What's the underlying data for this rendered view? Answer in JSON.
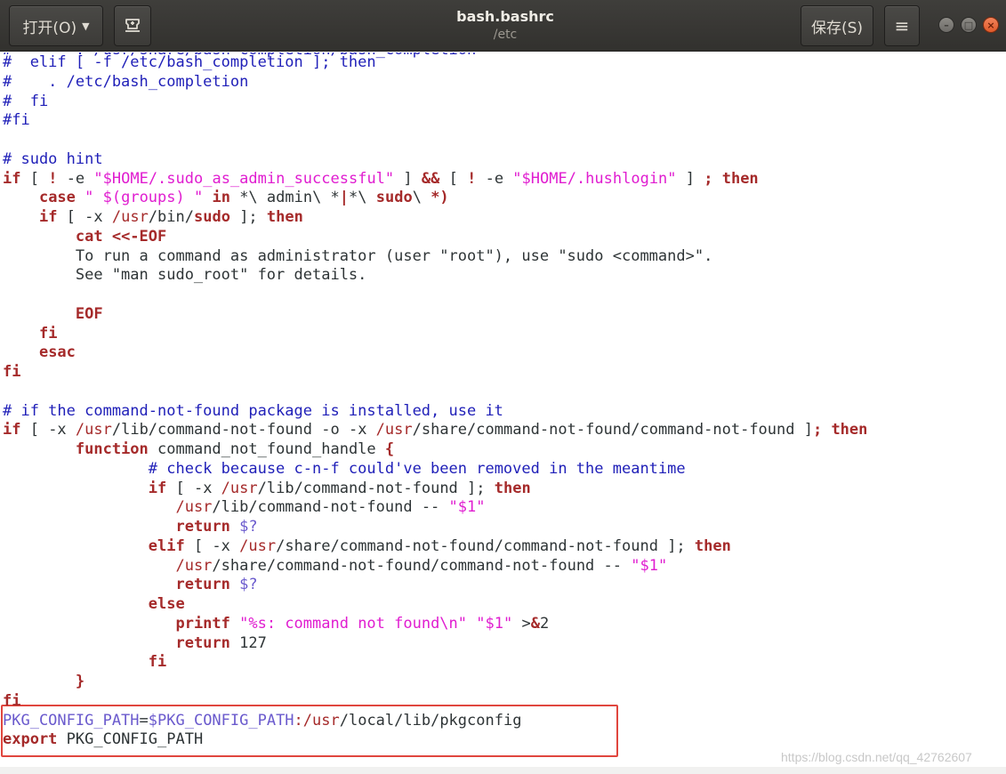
{
  "header": {
    "open_label": "打开(O)",
    "title": "bash.bashrc",
    "subtitle": "/etc",
    "save_label": "保存(S)",
    "pin_icon": "pin-icon",
    "menu_icon": "hamburger-menu-icon",
    "window_controls": [
      "minimize-icon",
      "maximize-icon",
      "close-icon"
    ]
  },
  "colors": {
    "comment": "#1f1fb8",
    "keyword": "#a52a2a",
    "string": "#e01dd0",
    "variable": "#6a5acd",
    "highlight_border": "#e0463e"
  },
  "editor": {
    "partial_top": "#       . /usr/share/bash-completion/bash_completion",
    "lines": [
      [
        [
          "comment",
          "#  elif [ -f /etc/bash_completion ]; then"
        ]
      ],
      [
        [
          "comment",
          "#    . /etc/bash_completion"
        ]
      ],
      [
        [
          "comment",
          "#  fi"
        ]
      ],
      [
        [
          "comment",
          "#fi"
        ]
      ],
      [],
      [
        [
          "comment",
          "# sudo hint"
        ]
      ],
      [
        [
          "keyword",
          "if"
        ],
        [
          "plain",
          " [ "
        ],
        [
          "keyword",
          "!"
        ],
        [
          "plain",
          " -e "
        ],
        [
          "string",
          "\"$HOME/.sudo_as_admin_successful\""
        ],
        [
          "plain",
          " ] "
        ],
        [
          "keyword",
          "&&"
        ],
        [
          "plain",
          " [ "
        ],
        [
          "keyword",
          "!"
        ],
        [
          "plain",
          " -e "
        ],
        [
          "string",
          "\"$HOME/.hushlogin\""
        ],
        [
          "plain",
          " ] "
        ],
        [
          "keyword",
          "; then"
        ]
      ],
      [
        [
          "plain",
          "    "
        ],
        [
          "keyword",
          "case"
        ],
        [
          "plain",
          " "
        ],
        [
          "string",
          "\" $(groups) \""
        ],
        [
          "plain",
          " "
        ],
        [
          "keyword",
          "in"
        ],
        [
          "plain",
          " *\\ admin\\ *"
        ],
        [
          "keyword",
          "|"
        ],
        [
          "plain",
          "*\\ "
        ],
        [
          "keyword",
          "sudo"
        ],
        [
          "plain",
          "\\ "
        ],
        [
          "keyword",
          "*)"
        ]
      ],
      [
        [
          "plain",
          "    "
        ],
        [
          "keyword",
          "if"
        ],
        [
          "plain",
          " [ -x "
        ],
        [
          "path",
          "/usr"
        ],
        [
          "plain",
          "/bin/"
        ],
        [
          "keyword",
          "sudo"
        ],
        [
          "plain",
          " ]; "
        ],
        [
          "keyword",
          "then"
        ]
      ],
      [
        [
          "plain",
          "        "
        ],
        [
          "keyword",
          "cat <<-EOF"
        ]
      ],
      [
        [
          "plain",
          "        To run a command as administrator (user \"root\"), use \"sudo <command>\"."
        ]
      ],
      [
        [
          "plain",
          "        See \"man sudo_root\" for details."
        ]
      ],
      [],
      [
        [
          "plain",
          "        "
        ],
        [
          "keyword",
          "EOF"
        ]
      ],
      [
        [
          "plain",
          "    "
        ],
        [
          "keyword",
          "fi"
        ]
      ],
      [
        [
          "plain",
          "    "
        ],
        [
          "keyword",
          "esac"
        ]
      ],
      [
        [
          "keyword",
          "fi"
        ]
      ],
      [],
      [
        [
          "comment",
          "# if the command-not-found package is installed, use it"
        ]
      ],
      [
        [
          "keyword",
          "if"
        ],
        [
          "plain",
          " [ -x "
        ],
        [
          "path",
          "/usr"
        ],
        [
          "plain",
          "/lib/command-not-found -o -x "
        ],
        [
          "path",
          "/usr"
        ],
        [
          "plain",
          "/share/command-not-found/command-not-found ]"
        ],
        [
          "keyword",
          "; then"
        ]
      ],
      [
        [
          "plain",
          "        "
        ],
        [
          "keyword",
          "function"
        ],
        [
          "plain",
          " command_not_found_handle "
        ],
        [
          "keyword",
          "{"
        ]
      ],
      [
        [
          "plain",
          "                "
        ],
        [
          "comment",
          "# check because c-n-f could've been removed in the meantime"
        ]
      ],
      [
        [
          "plain",
          "                "
        ],
        [
          "keyword",
          "if"
        ],
        [
          "plain",
          " [ -x "
        ],
        [
          "path",
          "/usr"
        ],
        [
          "plain",
          "/lib/command-not-found ]; "
        ],
        [
          "keyword",
          "then"
        ]
      ],
      [
        [
          "plain",
          "                   "
        ],
        [
          "path",
          "/usr"
        ],
        [
          "plain",
          "/lib/command-not-found -- "
        ],
        [
          "string",
          "\"$1\""
        ]
      ],
      [
        [
          "plain",
          "                   "
        ],
        [
          "keyword",
          "return"
        ],
        [
          "plain",
          " "
        ],
        [
          "var",
          "$?"
        ]
      ],
      [
        [
          "plain",
          "                "
        ],
        [
          "keyword",
          "elif"
        ],
        [
          "plain",
          " [ -x "
        ],
        [
          "path",
          "/usr"
        ],
        [
          "plain",
          "/share/command-not-found/command-not-found ]; "
        ],
        [
          "keyword",
          "then"
        ]
      ],
      [
        [
          "plain",
          "                   "
        ],
        [
          "path",
          "/usr"
        ],
        [
          "plain",
          "/share/command-not-found/command-not-found -- "
        ],
        [
          "string",
          "\"$1\""
        ]
      ],
      [
        [
          "plain",
          "                   "
        ],
        [
          "keyword",
          "return"
        ],
        [
          "plain",
          " "
        ],
        [
          "var",
          "$?"
        ]
      ],
      [
        [
          "plain",
          "                "
        ],
        [
          "keyword",
          "else"
        ]
      ],
      [
        [
          "plain",
          "                   "
        ],
        [
          "keyword",
          "printf"
        ],
        [
          "plain",
          " "
        ],
        [
          "string",
          "\"%s: command not found\\n\""
        ],
        [
          "plain",
          " "
        ],
        [
          "string",
          "\"$1\""
        ],
        [
          "plain",
          " >"
        ],
        [
          "keyword",
          "&"
        ],
        [
          "plain",
          "2"
        ]
      ],
      [
        [
          "plain",
          "                   "
        ],
        [
          "keyword",
          "return"
        ],
        [
          "plain",
          " 127"
        ]
      ],
      [
        [
          "plain",
          "                "
        ],
        [
          "keyword",
          "fi"
        ]
      ],
      [
        [
          "plain",
          "        "
        ],
        [
          "keyword",
          "}"
        ]
      ],
      [
        [
          "keyword",
          "fi"
        ]
      ],
      [
        [
          "var",
          "PKG_CONFIG_PATH"
        ],
        [
          "plain",
          "="
        ],
        [
          "var",
          "$PKG_CONFIG_PATH"
        ],
        [
          "path",
          ":/usr"
        ],
        [
          "plain",
          "/local/lib/pkgconfig"
        ]
      ],
      [
        [
          "keyword",
          "export"
        ],
        [
          "plain",
          " PKG_CONFIG_PATH"
        ]
      ]
    ]
  },
  "watermark": "https://blog.csdn.net/qq_42762607"
}
